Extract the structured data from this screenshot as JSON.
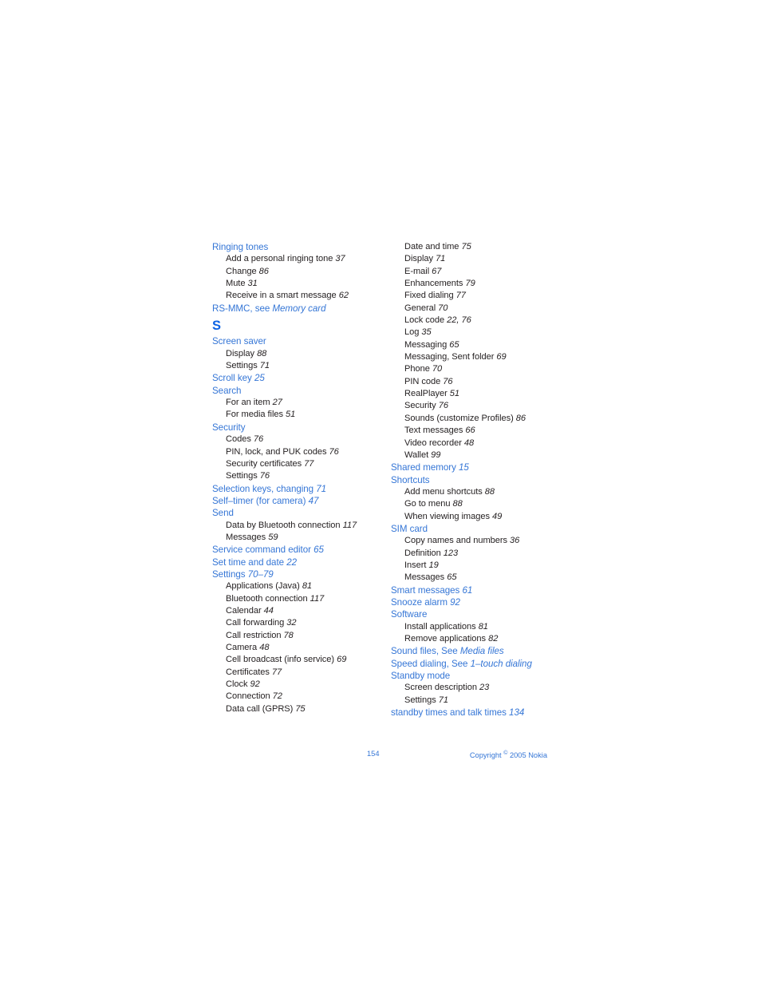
{
  "document": {
    "type": "index-page",
    "accent_color": "#3576D6",
    "section_letter_color": "#0D63E4",
    "body_text_color": "#231f20"
  },
  "footer": {
    "page_number": "154",
    "copyright_prefix": "Copyright ",
    "copyright_symbol": "©",
    "copyright_suffix": " 2005 Nokia"
  },
  "columns": {
    "left": [
      {
        "level": 1,
        "text": "Ringing tones"
      },
      {
        "level": 2,
        "text": "Add a personal ringing tone ",
        "number": "37"
      },
      {
        "level": 2,
        "text": "Change ",
        "number": "86"
      },
      {
        "level": 2,
        "text": "Mute ",
        "number": "31"
      },
      {
        "level": 2,
        "text": "Receive in a smart message ",
        "number": "62"
      },
      {
        "level": 1,
        "text": "RS-MMC, see ",
        "italic": "Memory card"
      },
      {
        "level": 0,
        "text": "S"
      },
      {
        "level": 1,
        "text": "Screen saver"
      },
      {
        "level": 2,
        "text": "Display ",
        "number": "88"
      },
      {
        "level": 2,
        "text": "Settings ",
        "number": "71"
      },
      {
        "level": 1,
        "text": "Scroll key ",
        "number": "25"
      },
      {
        "level": 1,
        "text": "Search"
      },
      {
        "level": 2,
        "text": "For an item ",
        "number": "27"
      },
      {
        "level": 2,
        "text": "For media files ",
        "number": "51"
      },
      {
        "level": 1,
        "text": "Security"
      },
      {
        "level": 2,
        "text": "Codes ",
        "number": "76"
      },
      {
        "level": 2,
        "text": "PIN, lock, and PUK codes ",
        "number": "76"
      },
      {
        "level": 2,
        "text": "Security certificates ",
        "number": "77"
      },
      {
        "level": 2,
        "text": "Settings ",
        "number": "76"
      },
      {
        "level": 1,
        "text": "Selection keys, changing ",
        "number": "71"
      },
      {
        "level": 1,
        "text": "Self–timer (for camera) ",
        "number": "47"
      },
      {
        "level": 1,
        "text": "Send"
      },
      {
        "level": 2,
        "text": "Data by Bluetooth connection ",
        "number": "117"
      },
      {
        "level": 2,
        "text": "Messages ",
        "number": "59"
      },
      {
        "level": 1,
        "text": "Service command editor ",
        "number": "65"
      },
      {
        "level": 1,
        "text": "Set time and date ",
        "number": "22"
      },
      {
        "level": 1,
        "text": "Settings ",
        "number": "70–79"
      },
      {
        "level": 2,
        "text": "Applications (Java) ",
        "number": "81"
      },
      {
        "level": 2,
        "text": "Bluetooth connection ",
        "number": "117"
      },
      {
        "level": 2,
        "text": "Calendar ",
        "number": "44"
      },
      {
        "level": 2,
        "text": "Call forwarding ",
        "number": "32"
      },
      {
        "level": 2,
        "text": "Call restriction ",
        "number": "78"
      },
      {
        "level": 2,
        "text": "Camera ",
        "number": "48"
      },
      {
        "level": 2,
        "text": "Cell broadcast (info service) ",
        "number": "69"
      },
      {
        "level": 2,
        "text": "Certificates ",
        "number": "77"
      },
      {
        "level": 2,
        "text": "Clock ",
        "number": "92"
      },
      {
        "level": 2,
        "text": "Connection ",
        "number": "72"
      },
      {
        "level": 2,
        "text": "Data call (GPRS) ",
        "number": "75"
      }
    ],
    "right": [
      {
        "level": 2,
        "text": "Date and time ",
        "number": "75"
      },
      {
        "level": 2,
        "text": "Display ",
        "number": "71"
      },
      {
        "level": 2,
        "text": "E-mail ",
        "number": "67"
      },
      {
        "level": 2,
        "text": "Enhancements ",
        "number": "79"
      },
      {
        "level": 2,
        "text": "Fixed dialing ",
        "number": "77"
      },
      {
        "level": 2,
        "text": "General ",
        "number": "70"
      },
      {
        "level": 2,
        "text": "Lock code ",
        "number": "22, 76"
      },
      {
        "level": 2,
        "text": "Log ",
        "number": "35"
      },
      {
        "level": 2,
        "text": "Messaging ",
        "number": "65"
      },
      {
        "level": 2,
        "text": "Messaging, Sent folder ",
        "number": "69"
      },
      {
        "level": 2,
        "text": "Phone ",
        "number": "70"
      },
      {
        "level": 2,
        "text": "PIN code ",
        "number": "76"
      },
      {
        "level": 2,
        "text": "RealPlayer ",
        "number": "51"
      },
      {
        "level": 2,
        "text": "Security ",
        "number": "76"
      },
      {
        "level": 2,
        "text": "Sounds (customize Profiles) ",
        "number": "86"
      },
      {
        "level": 2,
        "text": "Text messages ",
        "number": "66"
      },
      {
        "level": 2,
        "text": "Video recorder ",
        "number": "48"
      },
      {
        "level": 2,
        "text": "Wallet ",
        "number": "99"
      },
      {
        "level": 1,
        "text": "Shared memory ",
        "number": "15"
      },
      {
        "level": 1,
        "text": "Shortcuts"
      },
      {
        "level": 2,
        "text": "Add menu shortcuts ",
        "number": "88"
      },
      {
        "level": 2,
        "text": "Go to menu ",
        "number": "88"
      },
      {
        "level": 2,
        "text": "When viewing images ",
        "number": "49"
      },
      {
        "level": 1,
        "text": "SIM card"
      },
      {
        "level": 2,
        "text": "Copy names and numbers ",
        "number": "36"
      },
      {
        "level": 2,
        "text": "Definition ",
        "number": "123"
      },
      {
        "level": 2,
        "text": "Insert ",
        "number": "19"
      },
      {
        "level": 2,
        "text": "Messages ",
        "number": "65"
      },
      {
        "level": 1,
        "text": "Smart messages ",
        "number": "61"
      },
      {
        "level": 1,
        "text": "Snooze alarm ",
        "number": "92"
      },
      {
        "level": 1,
        "text": "Software"
      },
      {
        "level": 2,
        "text": "Install applications ",
        "number": "81"
      },
      {
        "level": 2,
        "text": "Remove applications ",
        "number": "82"
      },
      {
        "level": 1,
        "text": "Sound files, See ",
        "italic": "Media files"
      },
      {
        "level": 1,
        "text": "Speed dialing, See ",
        "italic": "1–touch dialing"
      },
      {
        "level": 1,
        "text": "Standby mode"
      },
      {
        "level": 2,
        "text": "Screen description ",
        "number": "23"
      },
      {
        "level": 2,
        "text": "Settings ",
        "number": "71"
      },
      {
        "level": 1,
        "text": "standby times and talk times ",
        "number": "134"
      }
    ]
  }
}
